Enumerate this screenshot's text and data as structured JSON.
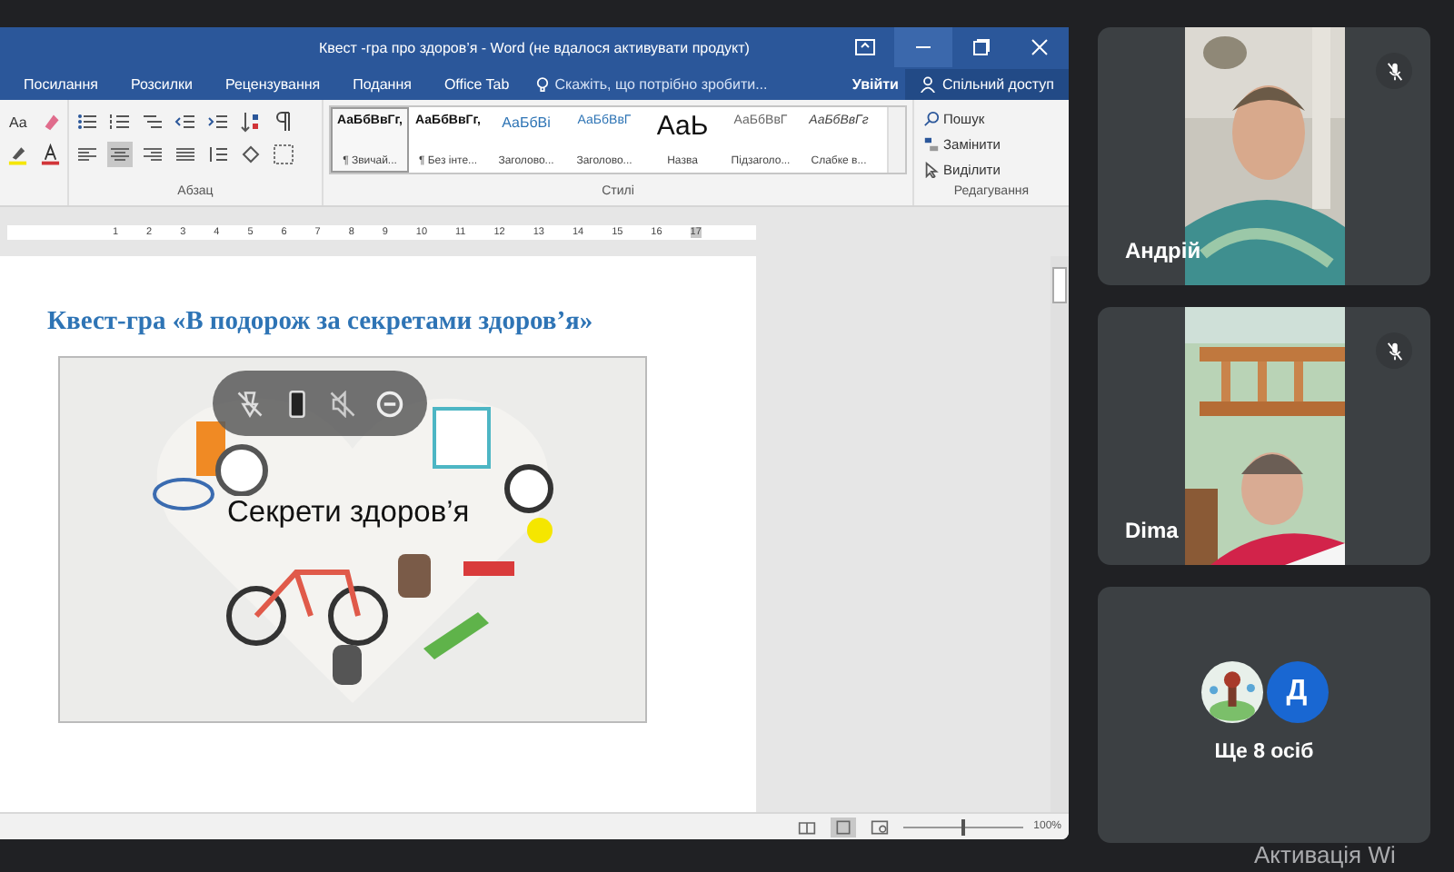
{
  "word_window": {
    "title": "Квест -гра про здоров’я - Word (не вдалося активувати продукт)"
  },
  "ribbon_tabs": [
    {
      "label": "Посилання"
    },
    {
      "label": "Розсилки"
    },
    {
      "label": "Рецензування"
    },
    {
      "label": "Подання"
    },
    {
      "label": "Office Tab"
    }
  ],
  "tell_me": {
    "placeholder": "Скажіть, що потрібно зробити..."
  },
  "sign_in": "Увійти",
  "share": "Спільний доступ",
  "font_group": {
    "case_button": "Aa"
  },
  "paragraph_group": {
    "label": "Абзац"
  },
  "styles_group": {
    "label": "Стилі",
    "styles": [
      {
        "preview": "АаБбВвГг,",
        "name": "¶ Звичай...",
        "kind": "normal",
        "selected": true
      },
      {
        "preview": "АаБбВвГг,",
        "name": "¶ Без інте...",
        "kind": "normal",
        "selected": false
      },
      {
        "preview": "АаБбВі",
        "name": "Заголово...",
        "kind": "heading",
        "selected": false
      },
      {
        "preview": "АаБбВвГ",
        "name": "Заголово...",
        "kind": "heading2",
        "selected": false
      },
      {
        "preview": "АаЬ",
        "name": "Назва",
        "kind": "title",
        "selected": false
      },
      {
        "preview": "АаБбВвГ",
        "name": "Підзаголо...",
        "kind": "subtitle",
        "selected": false
      },
      {
        "preview": "АаБбВвГг",
        "name": "Слабке в...",
        "kind": "emphasis",
        "selected": false
      }
    ]
  },
  "editing_group": {
    "label": "Редагування",
    "items": [
      {
        "label": "Пошук",
        "kind": "search"
      },
      {
        "label": "Замінити",
        "kind": "replace"
      },
      {
        "label": "Виділити",
        "kind": "select"
      }
    ]
  },
  "ruler": [
    "1",
    "2",
    "3",
    "4",
    "5",
    "6",
    "7",
    "8",
    "9",
    "10",
    "11",
    "12",
    "13",
    "14",
    "15",
    "16",
    "17"
  ],
  "document": {
    "heading": "Квест-гра «В подорож за секретами здоров’я»",
    "image_caption": "Секрети здоров’я"
  },
  "status_bar": {
    "zoom": "100%",
    "level": 0.5
  },
  "participants": [
    {
      "name": "Андрій",
      "muted": true,
      "kind": "picture"
    },
    {
      "name": "Dima",
      "muted": true,
      "kind": "picture"
    }
  ],
  "more_people": {
    "label": "Ще 8 осіб",
    "avatars": [
      {
        "kind": "picture"
      },
      {
        "kind": "letter",
        "letter": "Д",
        "color": "#1967d2"
      }
    ]
  },
  "os_notice": "Активація Wi"
}
